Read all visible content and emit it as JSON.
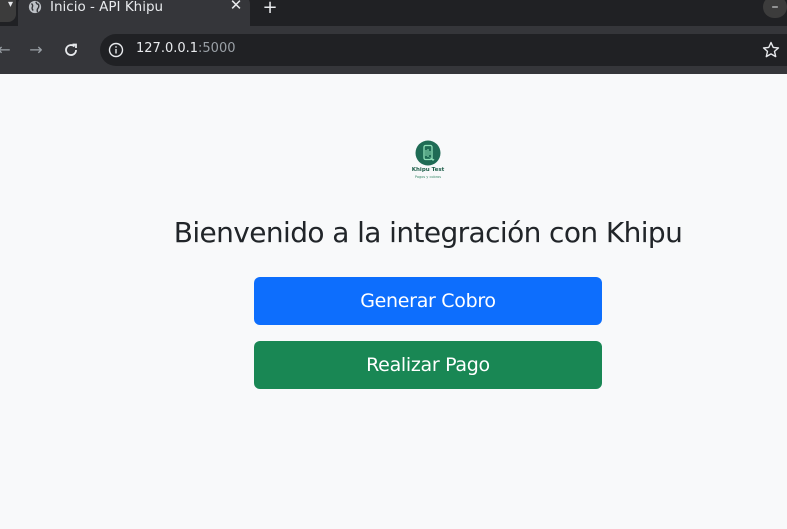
{
  "browser": {
    "tab": {
      "title": "Inicio - API Khipu",
      "favicon": "globe-icon",
      "close_icon": "close-icon"
    },
    "new_tab_icon": "plus-icon",
    "minimize_label": "–",
    "url": {
      "host": "127.0.0.1",
      "port": ":5000"
    },
    "icons": {
      "back": "arrow-left-icon",
      "forward": "arrow-right-icon",
      "reload": "reload-icon",
      "site_info": "info-icon",
      "bookmark": "star-icon"
    }
  },
  "page": {
    "logo": {
      "name": "Khipu Test",
      "tagline": "Pagos y cobros",
      "color": "#1f6b55"
    },
    "heading": "Bienvenido a la integración con Khipu",
    "buttons": {
      "generar_cobro": "Generar Cobro",
      "realizar_pago": "Realizar Pago"
    },
    "colors": {
      "primary": "#0d6efd",
      "success": "#198754",
      "background": "#f8f9fa"
    }
  }
}
